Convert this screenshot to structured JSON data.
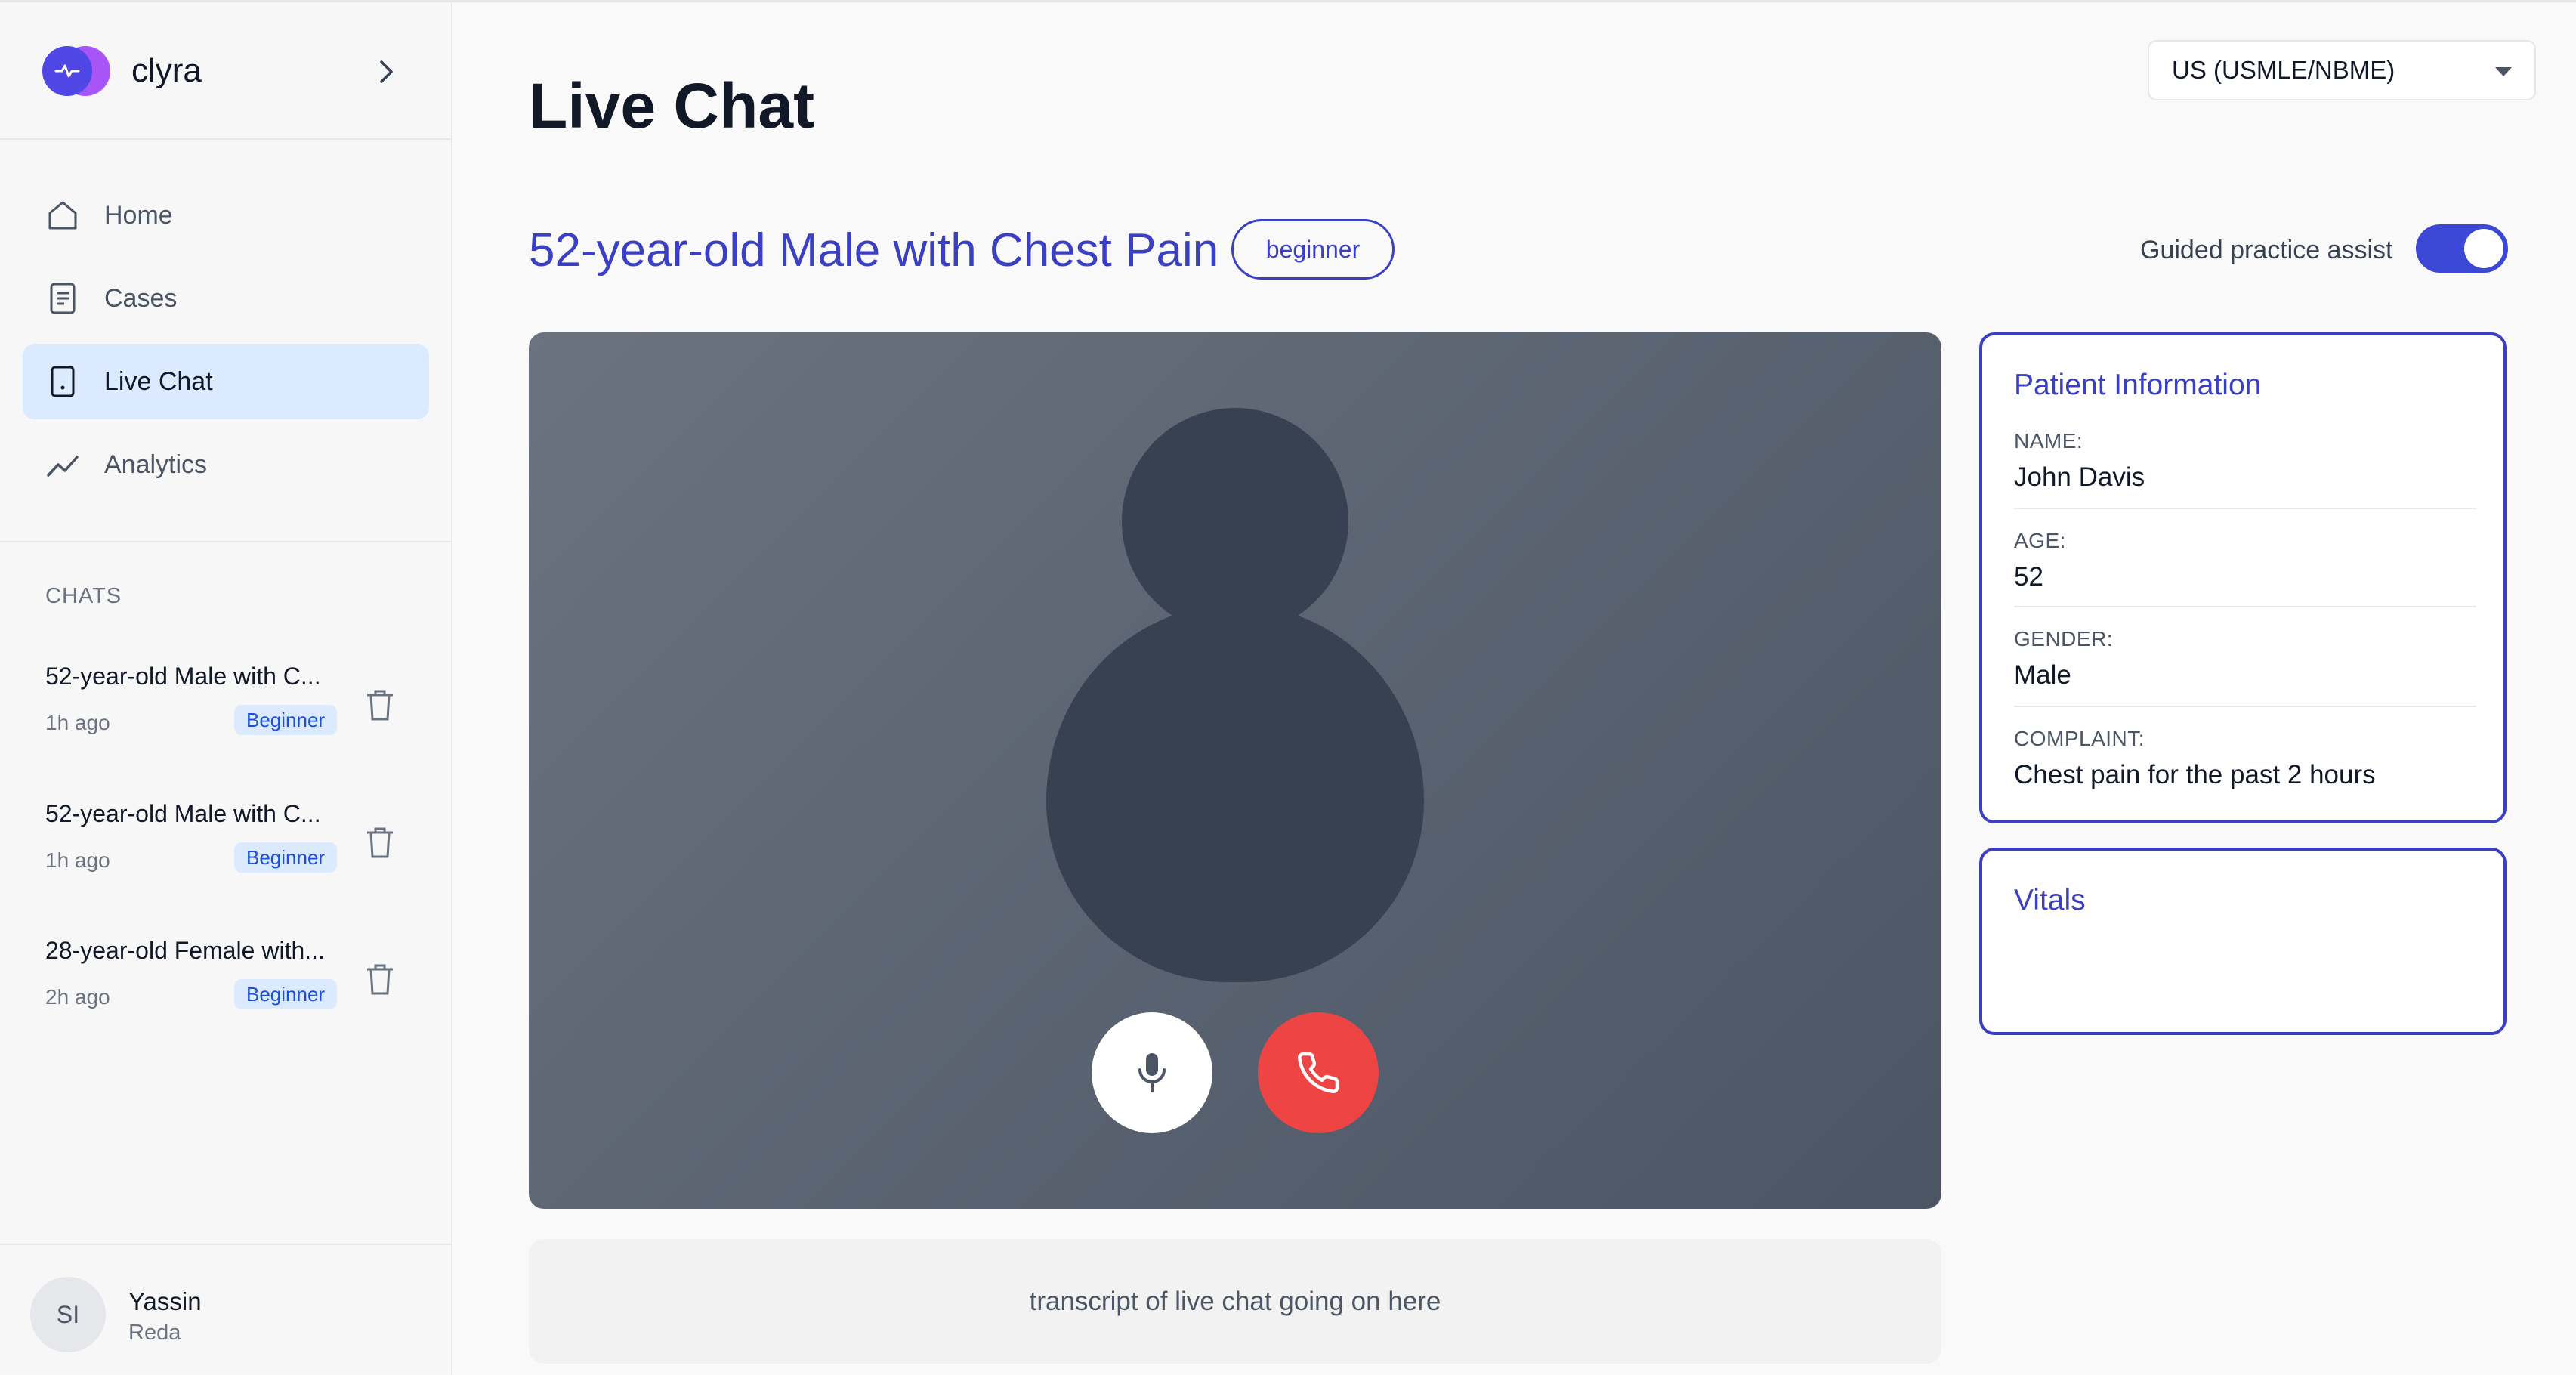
{
  "app": {
    "name": "clyra"
  },
  "sidebar": {
    "nav": [
      {
        "label": "Home",
        "icon": "home-icon"
      },
      {
        "label": "Cases",
        "icon": "document-icon"
      },
      {
        "label": "Live Chat",
        "icon": "tablet-icon",
        "active": true
      },
      {
        "label": "Analytics",
        "icon": "trend-icon"
      }
    ],
    "chats_title": "CHATS",
    "chats": [
      {
        "title": "52-year-old Male with C...",
        "time": "1h ago",
        "level": "Beginner"
      },
      {
        "title": "52-year-old Male with C...",
        "time": "1h ago",
        "level": "Beginner"
      },
      {
        "title": "28-year-old Female with...",
        "time": "2h ago",
        "level": "Beginner"
      }
    ],
    "user": {
      "initials": "SI",
      "name": "Yassin",
      "subtitle": "Reda"
    }
  },
  "header": {
    "title": "Live Chat",
    "region_select": "US (USMLE/NBME)"
  },
  "case": {
    "title": "52-year-old Male with Chest Pain",
    "level": "beginner",
    "assist_label": "Guided practice assist",
    "assist_enabled": true
  },
  "transcript": {
    "placeholder": "transcript of live chat going on here"
  },
  "patient": {
    "title": "Patient Information",
    "fields": [
      {
        "label": "NAME:",
        "value": "John Davis"
      },
      {
        "label": "AGE:",
        "value": "52"
      },
      {
        "label": "GENDER:",
        "value": "Male"
      },
      {
        "label": "COMPLAINT:",
        "value": "Chest pain for the past 2 hours"
      }
    ]
  },
  "vitals": {
    "title": "Vitals"
  },
  "colors": {
    "accent": "#3b3fc4",
    "toggle": "#3b48d6",
    "end_call": "#ef4444",
    "active_nav": "#dbeafe"
  }
}
